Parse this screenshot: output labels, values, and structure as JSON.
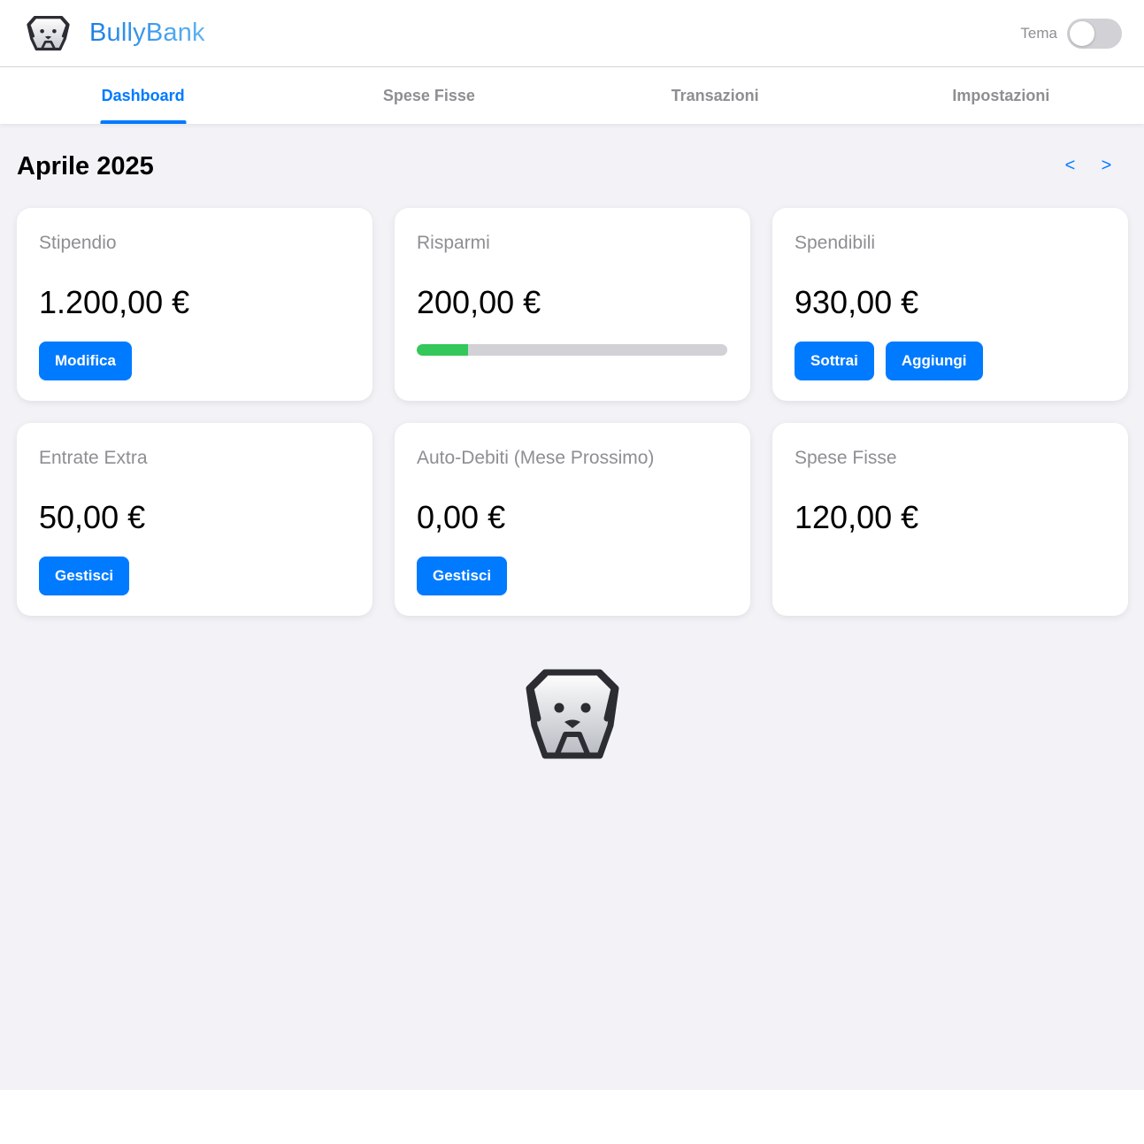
{
  "header": {
    "brand_name": "BullyBank",
    "logo_icon": "bulldog-logo-icon",
    "theme_label": "Tema",
    "theme_toggle_on": false
  },
  "tabs": [
    {
      "label": "Dashboard",
      "active": true
    },
    {
      "label": "Spese Fisse",
      "active": false
    },
    {
      "label": "Transazioni",
      "active": false
    },
    {
      "label": "Impostazioni",
      "active": false
    }
  ],
  "month": {
    "title": "Aprile 2025",
    "prev_label": "<",
    "next_label": ">"
  },
  "cards": {
    "stipendio": {
      "title": "Stipendio",
      "value": "1.200,00 €",
      "button": "Modifica"
    },
    "risparmi": {
      "title": "Risparmi",
      "value": "200,00 €",
      "progress_fraction": 0.165
    },
    "spendibili": {
      "title": "Spendibili",
      "value": "930,00 €",
      "button_subtract": "Sottrai",
      "button_add": "Aggiungi"
    },
    "entrate_extra": {
      "title": "Entrate Extra",
      "value": "50,00 €",
      "button": "Gestisci"
    },
    "auto_debiti": {
      "title": "Auto-Debiti (Mese Prossimo)",
      "value": "0,00 €",
      "button": "Gestisci"
    },
    "spese_fisse": {
      "title": "Spese Fisse",
      "value": "120,00 €"
    }
  },
  "colors": {
    "accent": "#007aff",
    "progress": "#34c759",
    "background": "#f2f2f7",
    "muted_text": "#8e8e93"
  }
}
